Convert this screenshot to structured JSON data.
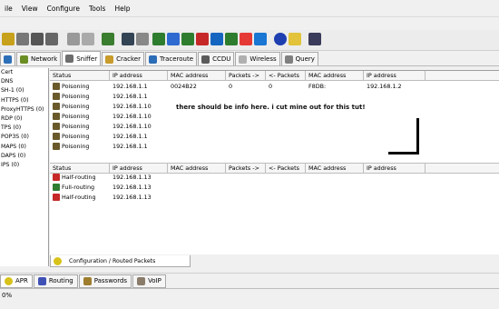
{
  "menu": [
    "ile",
    "View",
    "Configure",
    "Tools",
    "Help"
  ],
  "tabs": [
    {
      "label": "",
      "active": false
    },
    {
      "label": "Network",
      "active": false
    },
    {
      "label": "Sniffer",
      "active": true
    },
    {
      "label": "Cracker",
      "active": false
    },
    {
      "label": "Traceroute",
      "active": false
    },
    {
      "label": "CCDU",
      "active": false
    },
    {
      "label": "Wireless",
      "active": false
    },
    {
      "label": "Query",
      "active": false
    }
  ],
  "sidebar": [
    "Cert",
    "DNS",
    "SH-1 (0)",
    "HTTPS (0)",
    "ProxyHTTPS (0)",
    "RDP (0)",
    "TPS (0)",
    "POP3S (0)",
    "MAPS (0)",
    "DAPS (0)",
    "IPS (0)"
  ],
  "grid_top": {
    "headers": [
      "Status",
      "IP address",
      "MAC address",
      "Packets ->",
      "<- Packets",
      "MAC address",
      "IP address"
    ],
    "rows": [
      [
        "Poisoning",
        "192.168.1.1",
        "0024B22",
        "0",
        "0",
        "F8DB:",
        "192.168.1.2"
      ],
      [
        "Poisoning",
        "192.168.1.1",
        "",
        "",
        "",
        "",
        ""
      ],
      [
        "Poisoning",
        "192.168.1.10",
        "",
        "",
        "",
        "",
        ""
      ],
      [
        "Poisoning",
        "192.168.1.10",
        "",
        "",
        "",
        "",
        ""
      ],
      [
        "Poisoning",
        "192.168.1.10",
        "",
        "",
        "",
        "",
        ""
      ],
      [
        "Poisoning",
        "192.168.1.1",
        "",
        "",
        "",
        "",
        ""
      ],
      [
        "Poisoning",
        "192.168.1.1",
        "",
        "",
        "",
        "",
        ""
      ]
    ]
  },
  "note": "there should be info here. i cut mine out for this tut!",
  "grid_bottom": {
    "headers": [
      "Status",
      "IP address",
      "MAC address",
      "Packets ->",
      "<- Packets",
      "MAC address",
      "IP address"
    ],
    "rows": [
      [
        "Half-routing",
        "192.168.1.13"
      ],
      [
        "Full-routing",
        "192.168.1.13"
      ],
      [
        "Half-routing",
        "192.168.1.13"
      ]
    ]
  },
  "config_tab": "Configuration / Routed Packets",
  "bottom_tabs": [
    "APR",
    "Routing",
    "Passwords",
    "VoIP"
  ],
  "status": "0%"
}
